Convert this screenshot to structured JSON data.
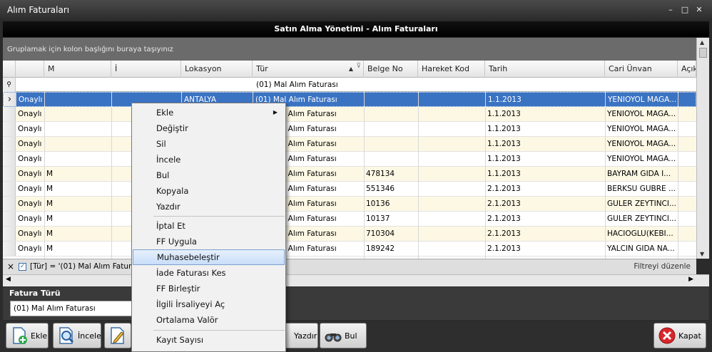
{
  "window": {
    "title": "Alım Faturaları",
    "min": "–",
    "max": "□",
    "close": "✕"
  },
  "header_title": "Satın Alma Yönetimi - Alım Faturaları",
  "group_panel_text": "Gruplamak için kolon başlığını buraya taşıyınız",
  "columns": [
    "",
    "M",
    "İ",
    "Lokasyon",
    "Tür",
    "Belge No",
    "Hareket Kod",
    "Tarih",
    "Cari Ünvan",
    "Açıkl"
  ],
  "filter_value": "(01) Mal Alım Faturası",
  "rows": [
    {
      "durum": "Onaylı",
      "m": "",
      "lokasyon": "ANTALYA",
      "tur": "(01) Mal Alım Faturası",
      "belge": "",
      "tarih": "1.1.2013",
      "cari": "YENIOYOL MAGA..."
    },
    {
      "durum": "Onaylı",
      "m": "",
      "lokasyon": "",
      "tur": "(01) Mal Alım Faturası",
      "belge": "",
      "tarih": "1.1.2013",
      "cari": "YENIOYOL MAGA..."
    },
    {
      "durum": "Onaylı",
      "m": "",
      "lokasyon": "",
      "tur": "(01) Mal Alım Faturası",
      "belge": "",
      "tarih": "1.1.2013",
      "cari": "YENIOYOL MAGA..."
    },
    {
      "durum": "Onaylı",
      "m": "",
      "lokasyon": "",
      "tur": "(01) Mal Alım Faturası",
      "belge": "",
      "tarih": "1.1.2013",
      "cari": "YENIOYOL MAGA..."
    },
    {
      "durum": "Onaylı",
      "m": "",
      "lokasyon": "",
      "tur": "(01) Mal Alım Faturası",
      "belge": "",
      "tarih": "1.1.2013",
      "cari": "YENIOYOL MAGA..."
    },
    {
      "durum": "Onaylı",
      "m": "M",
      "lokasyon": "",
      "tur": "(01) Mal Alım Faturası",
      "belge": "478134",
      "tarih": "1.1.2013",
      "cari": "BAYRAM GIDA I..."
    },
    {
      "durum": "Onaylı",
      "m": "M",
      "lokasyon": "",
      "tur": "(01) Mal Alım Faturası",
      "belge": "551346",
      "tarih": "2.1.2013",
      "cari": "BERKSU GUBRE ..."
    },
    {
      "durum": "Onaylı",
      "m": "M",
      "lokasyon": "",
      "tur": "(01) Mal Alım Faturası",
      "belge": "10136",
      "tarih": "2.1.2013",
      "cari": "GULER ZEYTINCI..."
    },
    {
      "durum": "Onaylı",
      "m": "M",
      "lokasyon": "",
      "tur": "(01) Mal Alım Faturası",
      "belge": "10137",
      "tarih": "2.1.2013",
      "cari": "GULER ZEYTINCI..."
    },
    {
      "durum": "Onaylı",
      "m": "M",
      "lokasyon": "",
      "tur": "(01) Mal Alım Faturası",
      "belge": "710304",
      "tarih": "2.1.2013",
      "cari": "HACIOGLU(KEBI..."
    },
    {
      "durum": "Onaylı",
      "m": "M",
      "lokasyon": "",
      "tur": "(01) Mal Alım Faturası",
      "belge": "189242",
      "tarih": "2.1.2013",
      "cari": "YALCIN GIDA NA..."
    }
  ],
  "filter_bar": {
    "close": "×",
    "expression": "[Tür] = '(01) Mal Alım Faturası'",
    "edit": "Filtreyi düzenle"
  },
  "fatura_turu": {
    "label": "Fatura Türü",
    "value": "(01) Mal Alım Faturası"
  },
  "toolbar": {
    "ekle": "Ekle",
    "incele": "İncele",
    "yazdir": "Yazdır",
    "bul": "Bul",
    "kapat": "Kapat"
  },
  "menu": {
    "ekle": "Ekle",
    "degistir": "Değiştir",
    "sil": "Sil",
    "incele": "İncele",
    "bul": "Bul",
    "kopyala": "Kopyala",
    "yazdir": "Yazdır",
    "iptal": "İptal Et",
    "ff_uygula": "FF Uygula",
    "muhasebe": "Muhasebeleştir",
    "iade": "İade Faturası Kes",
    "ff_birlestir": "FF Birleştir",
    "irsaliye": "İlgili İrsaliyeyi Aç",
    "ortalama": "Ortalama Valör",
    "kayit": "Kayıt Sayısı"
  }
}
